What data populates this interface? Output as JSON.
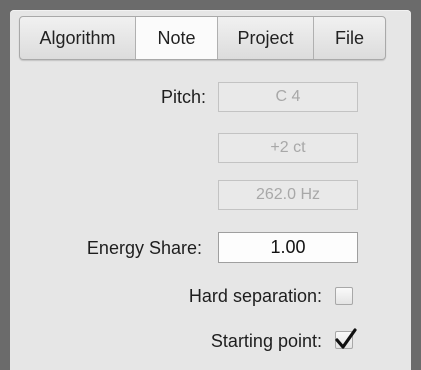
{
  "tabs": [
    {
      "label": "Algorithm",
      "active": false
    },
    {
      "label": "Note",
      "active": true
    },
    {
      "label": "Project",
      "active": false
    },
    {
      "label": "File",
      "active": false
    }
  ],
  "pitch": {
    "label": "Pitch:",
    "note": "C 4",
    "cents": "+2 ct",
    "frequency": "262.0 Hz"
  },
  "energy_share": {
    "label": "Energy Share:",
    "value": "1.00"
  },
  "hard_separation": {
    "label": "Hard separation:",
    "checked": false
  },
  "starting_point": {
    "label": "Starting point:",
    "checked": true
  }
}
